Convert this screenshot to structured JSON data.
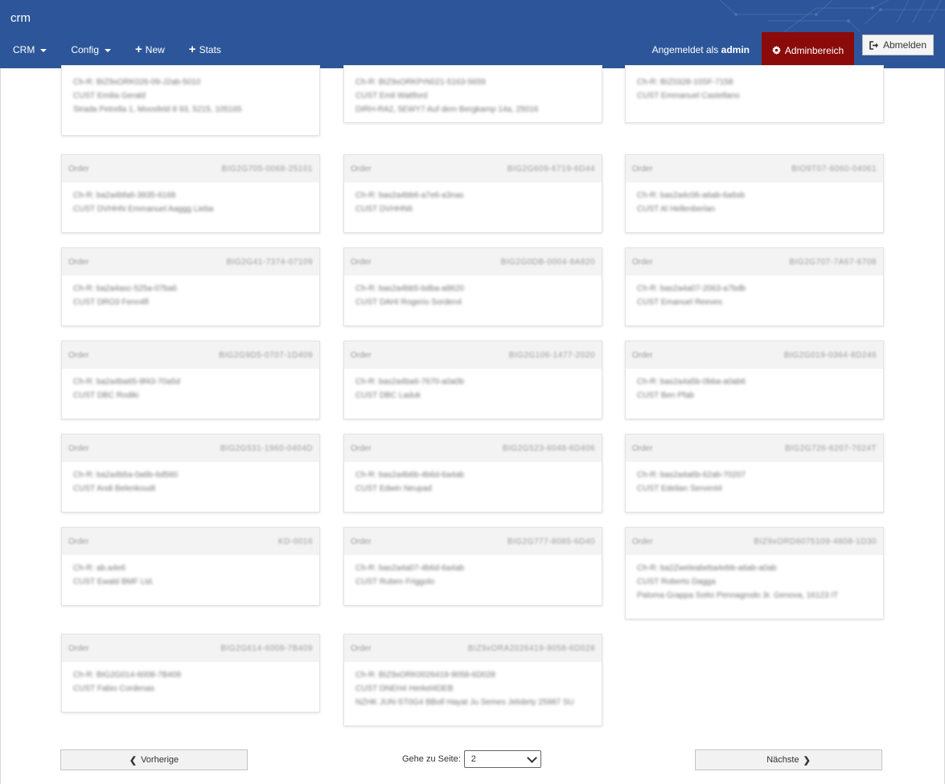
{
  "navbar": {
    "brand": "crm",
    "menu": [
      {
        "label": "CRM",
        "dropdown": true
      },
      {
        "label": "Config",
        "dropdown": true
      },
      {
        "label": "New",
        "icon": "plus-icon"
      },
      {
        "label": "Stats",
        "icon": "plus-icon"
      }
    ],
    "logged_prefix": "Angemeldet als",
    "logged_user": "admin",
    "admin_label": "Adminbereich",
    "logout_label": "Abmelden",
    "colors": {
      "navbar": "#2c5699",
      "admin": "#8b0a0a"
    }
  },
  "orders": {
    "cards": [
      {
        "head": "",
        "number": "",
        "lines": [
          "Ch-R: BIZ9xORK026-09-J2ab-5010",
          "CUST Emilia Gerald",
          "Strada Petrella 1, Moosfeld 8 93, 5215, 105165"
        ]
      },
      {
        "head": "",
        "number": "",
        "lines": [
          "Ch-R: BIZ9xORKPrN021-5163-5659",
          "CUST Emil Wattford",
          "DIRH-RA2, 5EWY7 Auf dem Bergkamp 14a, 25016"
        ]
      },
      {
        "head": "",
        "number": "",
        "lines": [
          "Ch-R: BIZ0328-10SF-7158",
          "CUST Emmanuel Castellano"
        ]
      },
      {
        "head": "Order",
        "number": "BIG2G705-0068-25101",
        "lines": [
          "Ch-R: ba2a4bfa6-3935-6168",
          "CUST DVHHN Emmanuel Aaggg Lieba"
        ]
      },
      {
        "head": "Order",
        "number": "BIG2G609-6719-6D44",
        "lines": [
          "Ch-R: bas2a4bb6-a7e6-a3nas",
          "CUST DVHHN6"
        ]
      },
      {
        "head": "Order",
        "number": "BIO9T07-6060-04061",
        "lines": [
          "Ch-R: bas2a4c06-a6ab-6a6sb",
          "CUST Al Hellenberlan"
        ]
      },
      {
        "head": "Order",
        "number": "BIG2G41-7374-07109",
        "lines": [
          "Ch-R: ba2a4asc-525a-07ba6",
          "CUST DRO3 Fenn4fl"
        ]
      },
      {
        "head": "Order",
        "number": "BIG2G0DB-0004-8A820",
        "lines": [
          "Ch-R: bas2a4bb5-bdba-a8620",
          "CUST DAHI Rogerio Sorden4"
        ]
      },
      {
        "head": "Order",
        "number": "BIG2G707-7A67-6708",
        "lines": [
          "Ch-R: bas2a4a07-2063-a7bdb",
          "CUST Emanuel Reeves"
        ]
      },
      {
        "head": "Order",
        "number": "BIG2G9D5-0707-1D409",
        "lines": [
          "Ch-R: ba2a4ba65-9f43-70a5d",
          "CUST DBC Rodiki"
        ]
      },
      {
        "head": "Order",
        "number": "BIG2G106-1477-2020",
        "lines": [
          "Ch-R: bas2a4ba6-7670-a0a0b",
          "CUST DBC Laduk"
        ]
      },
      {
        "head": "Order",
        "number": "BIG2G019-0364-8D246",
        "lines": [
          "Ch-R: bas2a4a5b-0bba-a0ab6",
          "CUST Ben Pfab"
        ]
      },
      {
        "head": "Order",
        "number": "BIG2G531-1960-0404D",
        "lines": [
          "Ch-R: ba2a4b5a-0a6b-6d560",
          "CUST Andi Belenkoudt"
        ]
      },
      {
        "head": "Order",
        "number": "BIG2G523-6048-6D406",
        "lines": [
          "Ch-R: bas2a4b6b-4b6d-6a4ab",
          "CUST Edwin Neupad"
        ]
      },
      {
        "head": "Order",
        "number": "BIG2G726-6207-7024T",
        "lines": [
          "Ch-R: bas2a4a6b-62ab-70207",
          "CUST Edelian Servent4"
        ]
      },
      {
        "head": "Order",
        "number": "KD-0016",
        "lines": [
          "Ch-R: ab.a4e6",
          "CUST Ewald BMF Ltd."
        ]
      },
      {
        "head": "Order",
        "number": "BIG2G777-8085-6D40",
        "lines": [
          "Ch-R: bas2a4a07-4b6d-6a4ab",
          "CUST Ruben Friggolo"
        ]
      },
      {
        "head": "Order",
        "number": "BIZ9xORD6075109-4808-1D30",
        "lines": [
          "Ch-R: ba2Zweleabeba4ebb-a6ab-a0ab",
          "CUST Roberto Dagga",
          "Paloma Grappa Sotto Pennagrodo 3r. Genova, 16123 IT"
        ]
      },
      {
        "head": "Order",
        "number": "BIG2G614-6008-7B409",
        "lines": [
          "Ch-R: BIG2G014-6008-7B409",
          "CUST Fabio Cordenas"
        ]
      },
      {
        "head": "Order",
        "number": "BIZ9xORA2026419-9058-6D028",
        "lines": [
          "Ch-R: BIZ9xORK0026419-9058-6D028",
          "CUST DNEH4 Herkel4DEB",
          "NZHK JUN-ST0G4 BBoll Hayat Ju Semes Jelobrty 25987 SU"
        ]
      }
    ]
  },
  "pager": {
    "prev_label": "Vorherige",
    "next_label": "Nächste",
    "goto_label": "Gehe zu Seite:",
    "current_page": "2"
  }
}
